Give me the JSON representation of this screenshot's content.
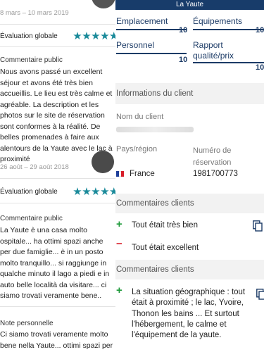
{
  "left": {
    "review1": {
      "date": "8 mars – 10 mars 2019",
      "overall_label": "Évaluation globale",
      "stars": "★★★★★",
      "comment_title": "Commentaire public",
      "comment": "Nous avons passé un excellent séjour et avons été très bien accueillis. Le lieu est très calme et agréable. La description et les photos sur le site de réservation sont conformes à la réalité. De belles promenades à faire aux alentours de la Yaute avec le lac à proximité"
    },
    "review2": {
      "date": "26 août – 29 août 2018",
      "overall_label": "Évaluation globale",
      "stars": "★★★★★",
      "comment_title": "Commentaire public",
      "comment": "La Yaute è una casa molto ospitale... ha ottimi spazi anche per due famiglie... è in un posto molto tranquillo... si raggiunge in qualche minuto il lago a piedi e in auto belle località da visitare... ci siamo trovati veramente bene..",
      "note_title": "Note personnelle",
      "note": "Ci siamo trovati veramente molto bene nella Yaute... ottimi spazi per"
    }
  },
  "right": {
    "banner": "La Yaute",
    "ratings": [
      {
        "label": "Emplacement",
        "score": "10"
      },
      {
        "label": "Équipements",
        "score": "10"
      },
      {
        "label": "Personnel",
        "score": "10"
      },
      {
        "label": "Rapport qualité/prix",
        "score": "10"
      }
    ],
    "client_section": "Informations du client",
    "client_name_label": "Nom du client",
    "client_name_value": "",
    "country_label": "Pays/région",
    "country_value": "France",
    "reservation_label": "Numéro de réservation",
    "reservation_value": "1981700773",
    "comments_section_1": "Commentaires clients",
    "positive_1": "Tout était très bien",
    "negative_1": "Tout était excellent",
    "comments_section_2": "Commentaires clients",
    "positive_2": "La situation géographique : tout était à proximité ; le lac, Yvoire, Thonon les bains ... Et surtout l'hébergement, le calme et l'équipement de la yaute.",
    "plus_glyph": "+",
    "minus_glyph": "−",
    "colors": {
      "accent": "#1c3b66",
      "stars": "#1a8a9a",
      "positive": "#1e9a3a",
      "negative": "#d81e2a"
    }
  }
}
